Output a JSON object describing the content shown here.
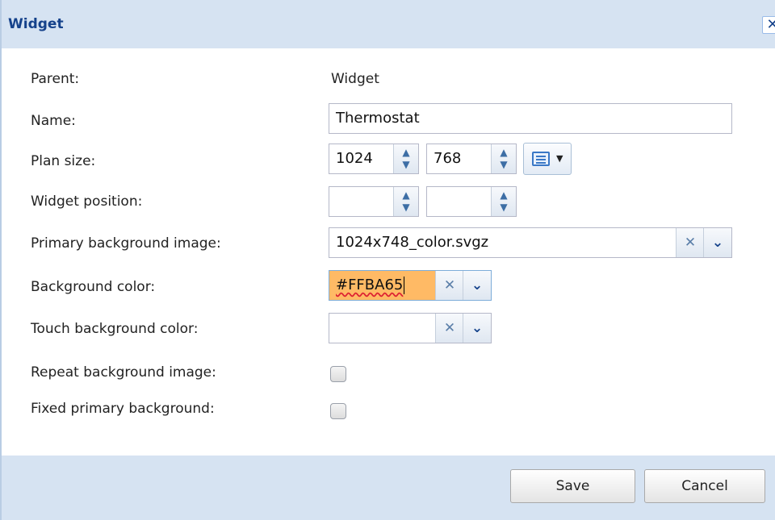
{
  "dialog": {
    "title": "Widget",
    "close_glyph": "✕"
  },
  "form": {
    "parent_label": "Parent:",
    "parent_value": "Widget",
    "name_label": "Name:",
    "name_value": "Thermostat",
    "plan_size_label": "Plan size:",
    "plan_width": "1024",
    "plan_height": "768",
    "widget_position_label": "Widget position:",
    "position_x": "",
    "position_y": "",
    "primary_bg_label": "Primary background image:",
    "primary_bg_value": "1024x748_color.svgz",
    "bg_color_label": "Background color:",
    "bg_color_value": "#FFBA65",
    "touch_bg_label": "Touch background color:",
    "touch_bg_value": "",
    "repeat_bg_label": "Repeat background image:",
    "repeat_bg_checked": false,
    "fixed_bg_label": "Fixed primary background:",
    "fixed_bg_checked": false
  },
  "footer": {
    "save_label": "Save",
    "cancel_label": "Cancel"
  },
  "colors": {
    "titlebar": "#d6e3f2",
    "title_text": "#15428b",
    "bg_color_swatch": "#ffba65"
  }
}
